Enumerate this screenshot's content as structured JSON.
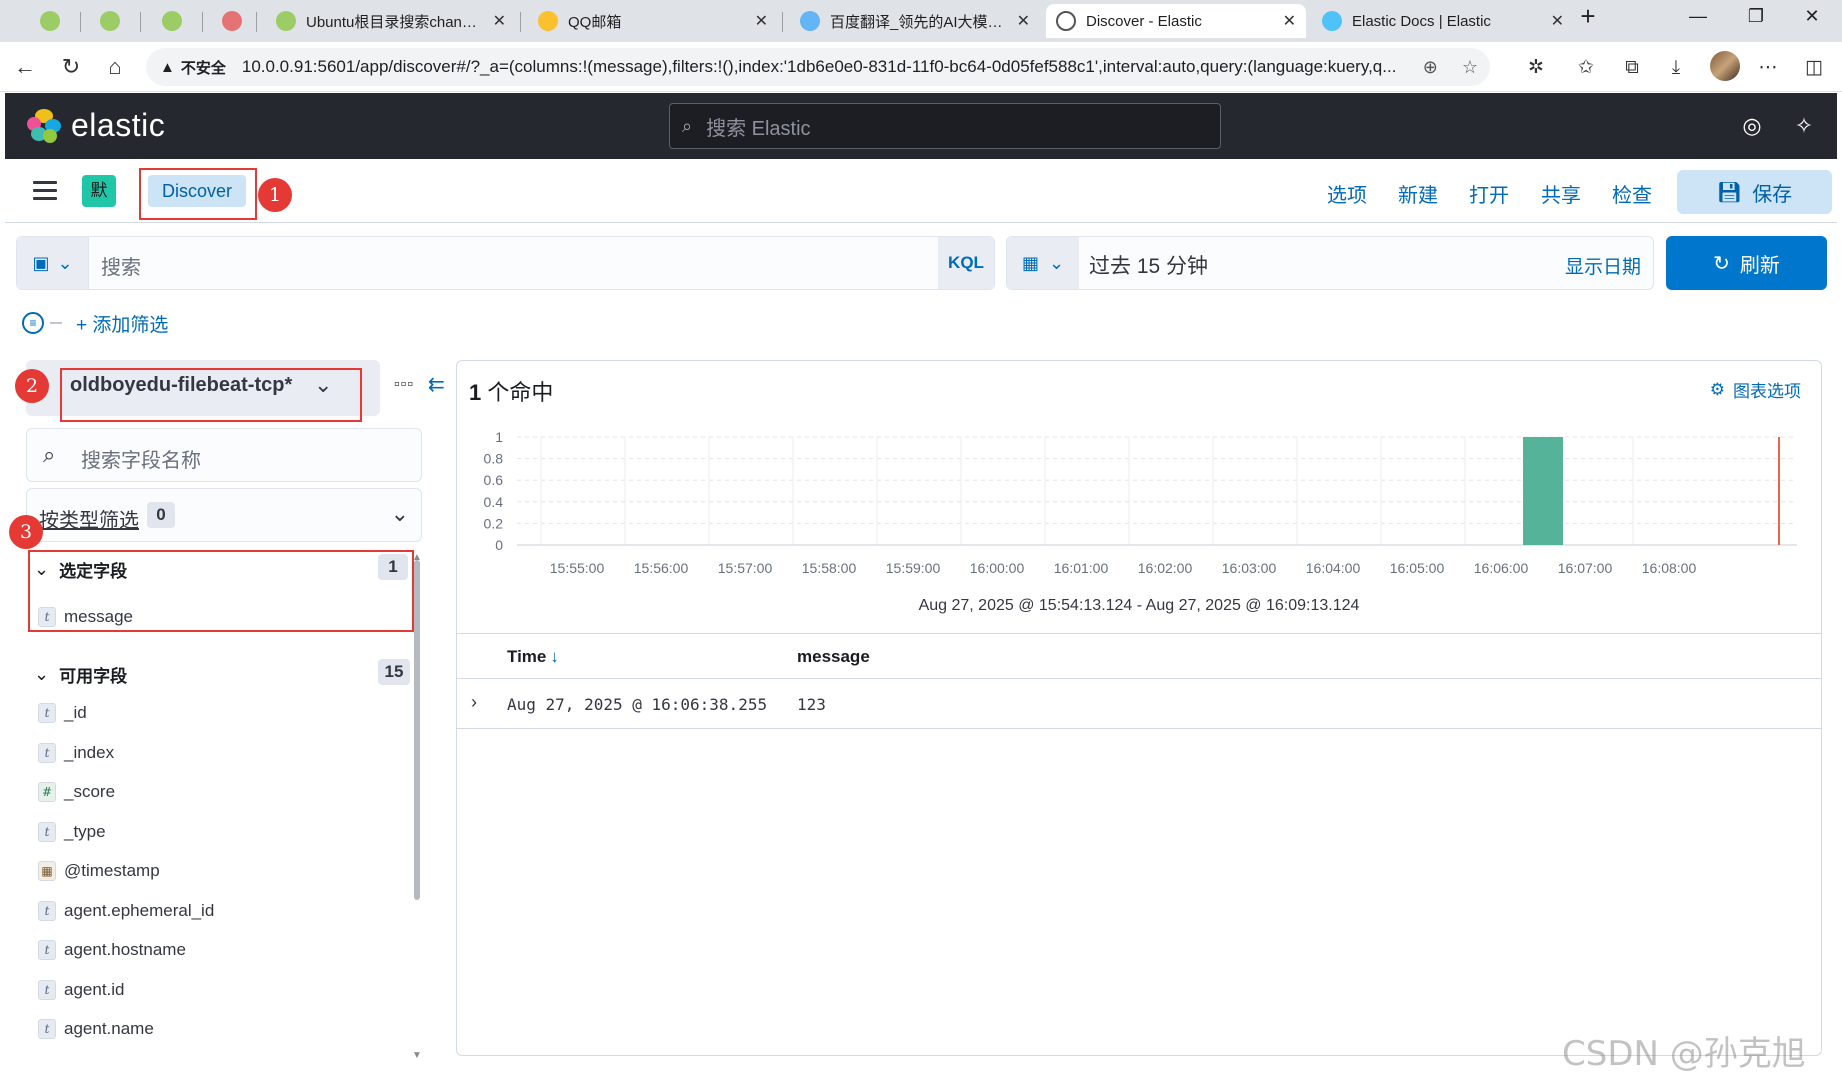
{
  "browser": {
    "tabs": [
      {
        "title": "",
        "color": "#9ccc65"
      },
      {
        "title": "",
        "color": "#9ccc65"
      },
      {
        "title": "",
        "color": "#9ccc65"
      },
      {
        "title": "",
        "color": "#e57373"
      },
      {
        "title": "Ubuntu根目录搜索change.s",
        "color": "#9ccc65"
      },
      {
        "title": "QQ邮箱",
        "color": "#fbc02d"
      },
      {
        "title": "百度翻译_领先的AI大模型翻",
        "color": "#64b5f6"
      },
      {
        "title": "Discover - Elastic",
        "color": "#ffffff"
      },
      {
        "title": "Elastic Docs | Elastic",
        "color": "#4fc3f7"
      }
    ],
    "insecure_label": "不安全",
    "url": "10.0.0.91:5601/app/discover#/?_a=(columns:!(message),filters:!(),index:'1db6e0e0-831d-11f0-bc64-0d05fef588c1',interval:auto,query:(language:kuery,q..."
  },
  "elastic": {
    "brand": "elastic",
    "search_placeholder": "搜索 Elastic"
  },
  "app": {
    "space_initial": "默",
    "breadcrumb": "Discover",
    "nav": [
      "选项",
      "新建",
      "打开",
      "共享",
      "检查"
    ],
    "save_label": "保存"
  },
  "query": {
    "placeholder": "搜索",
    "kql_label": "KQL",
    "time_text": "过去 15 分钟",
    "show_dates": "显示日期",
    "refresh_label": "刷新",
    "add_filter": "+ 添加筛选"
  },
  "sidebar": {
    "index_pattern": "oldboyedu-filebeat-tcp*",
    "field_search_placeholder": "搜索字段名称",
    "type_filter_label": "按类型筛选",
    "type_filter_count": "0",
    "selected_header": "选定字段",
    "selected_count": "1",
    "selected_fields": [
      {
        "name": "message",
        "type": "t"
      }
    ],
    "available_header": "可用字段",
    "available_count": "15",
    "available_fields": [
      {
        "name": "_id",
        "type": "t"
      },
      {
        "name": "_index",
        "type": "t"
      },
      {
        "name": "_score",
        "type": "#"
      },
      {
        "name": "_type",
        "type": "t"
      },
      {
        "name": "@timestamp",
        "type": "date"
      },
      {
        "name": "agent.ephemeral_id",
        "type": "t"
      },
      {
        "name": "agent.hostname",
        "type": "t"
      },
      {
        "name": "agent.id",
        "type": "t"
      },
      {
        "name": "agent.name",
        "type": "t"
      }
    ]
  },
  "annotations": [
    "1",
    "2",
    "3"
  ],
  "results": {
    "hits_count": "1",
    "hits_label": " 个命中",
    "chart_options": "图表选项",
    "time_range": "Aug 27, 2025 @ 15:54:13.124 - Aug 27, 2025 @ 16:09:13.124",
    "columns": [
      "Time",
      "message"
    ],
    "rows": [
      {
        "time": "Aug 27, 2025 @ 16:06:38.255",
        "message": "123"
      }
    ]
  },
  "chart_data": {
    "type": "bar",
    "categories": [
      "15:55:00",
      "15:56:00",
      "15:57:00",
      "15:58:00",
      "15:59:00",
      "16:00:00",
      "16:01:00",
      "16:02:00",
      "16:03:00",
      "16:04:00",
      "16:05:00",
      "16:06:00",
      "16:07:00",
      "16:08:00"
    ],
    "bars": [
      {
        "x": "16:06:00",
        "value": 1
      }
    ],
    "yticks": [
      "0",
      "0.2",
      "0.4",
      "0.6",
      "0.8",
      "1"
    ],
    "ylim": [
      0,
      1
    ],
    "bar_color": "#54b399",
    "now_marker_color": "#e7664c"
  },
  "watermark": "CSDN @孙克旭",
  "colors": {
    "accent": "#0077cc",
    "annotation": "#e53935"
  }
}
